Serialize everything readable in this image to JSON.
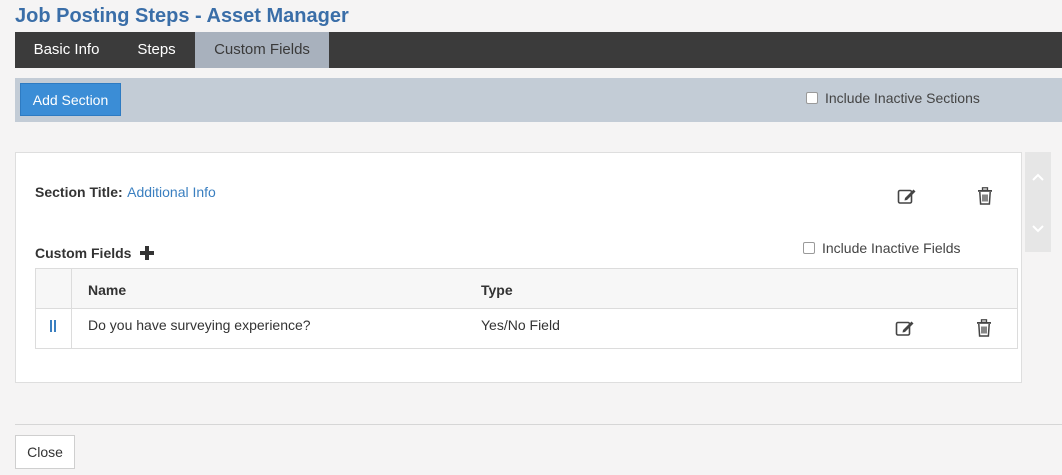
{
  "page": {
    "title": "Job Posting Steps - Asset Manager"
  },
  "tabs": [
    {
      "label": "Basic Info",
      "active": false
    },
    {
      "label": "Steps",
      "active": false
    },
    {
      "label": "Custom Fields",
      "active": true
    }
  ],
  "toolbar": {
    "add_section_label": "Add Section",
    "include_inactive_sections_label": "Include Inactive Sections",
    "include_inactive_sections_checked": false
  },
  "section": {
    "title_label": "Section Title:",
    "title_value": "Additional Info",
    "custom_fields_label": "Custom Fields",
    "include_inactive_fields_label": "Include Inactive Fields",
    "include_inactive_fields_checked": false,
    "table": {
      "columns": [
        "Name",
        "Type"
      ],
      "rows": [
        {
          "name": "Do you have surveying experience?",
          "type": "Yes/No Field"
        }
      ]
    }
  },
  "footer": {
    "close_label": "Close"
  },
  "icons": {
    "edit": "edit-icon",
    "delete": "trash-icon",
    "add": "plus-icon",
    "drag": "drag-handle-icon",
    "up": "chevron-up-icon",
    "down": "chevron-down-icon"
  },
  "colors": {
    "title": "#3a6ea8",
    "tabbar": "#3b3b3b",
    "active_tab": "#a8b1bd",
    "toolbar": "#c3ccd6",
    "primary_button": "#3b8dd6",
    "link": "#3a7fc0"
  }
}
